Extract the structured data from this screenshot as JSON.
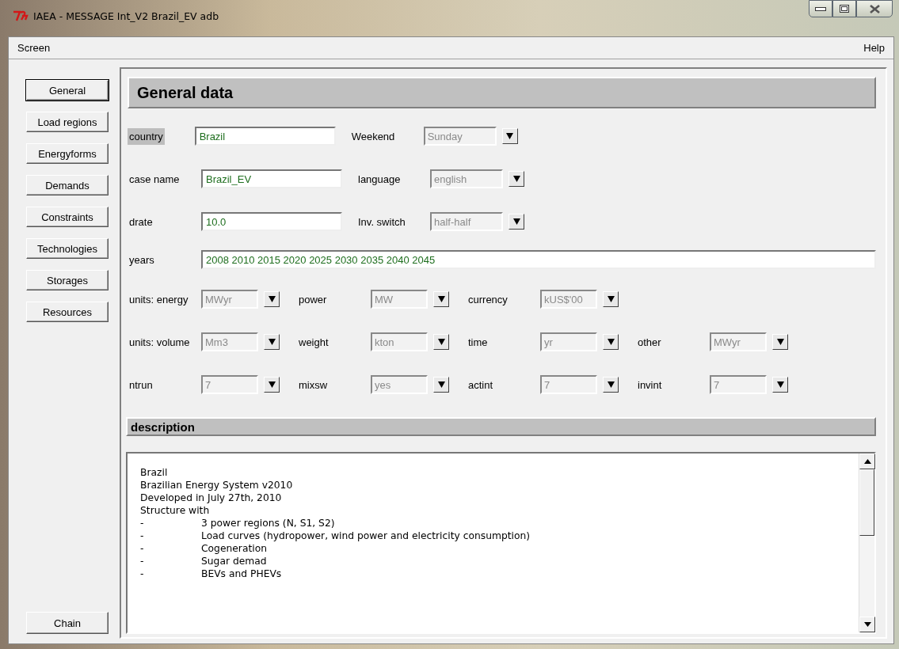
{
  "window": {
    "title": "IAEA - MESSAGE Int_V2 Brazil_EV adb"
  },
  "menu_bar": [
    {
      "label": "Screen"
    },
    {
      "label": "Help"
    }
  ],
  "sidebar": {
    "items": [
      {
        "label": "General",
        "selected": true
      },
      {
        "label": "Load regions",
        "selected": false
      },
      {
        "label": "Energyforms",
        "selected": false
      },
      {
        "label": "Demands",
        "selected": false
      },
      {
        "label": "Constraints",
        "selected": false
      },
      {
        "label": "Technologies",
        "selected": false
      },
      {
        "label": "Storages",
        "selected": false
      },
      {
        "label": "Resources",
        "selected": false
      }
    ],
    "footer_button": "Chain"
  },
  "panel": {
    "title": "General data",
    "rows": [
      {
        "items": [
          {
            "kind": "text",
            "label": "country",
            "value": "Brazil",
            "highlighted": true
          },
          {
            "kind": "combo",
            "label": "Weekend",
            "value": "Sunday",
            "disabled": true
          }
        ]
      },
      {
        "items": [
          {
            "kind": "text",
            "label": "case name",
            "value": "Brazil_EV",
            "highlighted": false
          },
          {
            "kind": "combo",
            "label": "language",
            "value": "english",
            "disabled": true
          }
        ]
      },
      {
        "items": [
          {
            "kind": "text",
            "label": "drate",
            "value": "10.0",
            "highlighted": false
          },
          {
            "kind": "combo",
            "label": "Inv. switch",
            "value": "half-half",
            "disabled": true
          }
        ]
      },
      {
        "items": [
          {
            "kind": "longtext",
            "label": "years",
            "value": "2008 2010 2015 2020 2025 2030 2035 2040 2045",
            "highlighted": false
          }
        ]
      },
      {
        "items": [
          {
            "kind": "combo",
            "label": "units: energy",
            "value": "MWyr",
            "disabled": true
          },
          {
            "kind": "combo",
            "label": "power",
            "value": "MW",
            "disabled": true
          },
          {
            "kind": "combo",
            "label": "currency",
            "value": "kUS$'00",
            "disabled": true
          }
        ]
      },
      {
        "items": [
          {
            "kind": "combo",
            "label": "units: volume",
            "value": "Mm3",
            "disabled": true
          },
          {
            "kind": "combo",
            "label": "weight",
            "value": "kton",
            "disabled": true
          },
          {
            "kind": "combo",
            "label": "time",
            "value": "yr",
            "disabled": true
          },
          {
            "kind": "combo",
            "label": "other",
            "value": "MWyr",
            "disabled": true
          }
        ]
      },
      {
        "items": [
          {
            "kind": "combo",
            "label": "ntrun",
            "value": "7",
            "disabled": true
          },
          {
            "kind": "combo",
            "label": "mixsw",
            "value": "yes",
            "disabled": true
          },
          {
            "kind": "combo",
            "label": "actint",
            "value": "7",
            "disabled": true
          },
          {
            "kind": "combo",
            "label": "invint",
            "value": "7",
            "disabled": true
          }
        ]
      }
    ],
    "description": {
      "header": "description",
      "lines": [
        {
          "text": "Brazil"
        },
        {
          "text": "Brazilian Energy System v2010"
        },
        {
          "text": "Developed in July 27th, 2010"
        },
        {
          "text": "Structure with"
        },
        {
          "marker": "-",
          "text": "3 power regions (N, S1, S2)"
        },
        {
          "marker": "-",
          "text": "Load curves (hydropower, wind power and electricity consumption)"
        },
        {
          "marker": "-",
          "text": "Cogeneration"
        },
        {
          "marker": "-",
          "text": "Sugar demad"
        },
        {
          "marker": "-",
          "text": "BEVs and PHEVs"
        }
      ]
    }
  }
}
